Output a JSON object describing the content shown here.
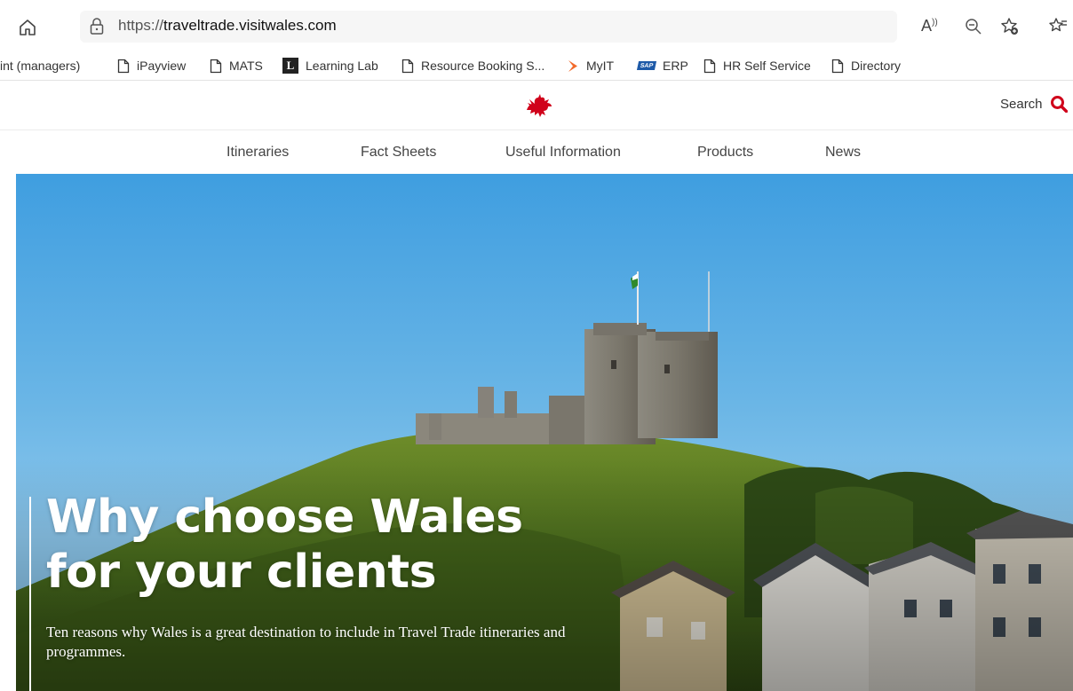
{
  "browser": {
    "url_prefix": "https://",
    "url_domain": "traveltrade.visitwales.com",
    "read_aloud_label": "A"
  },
  "bookmarks": [
    {
      "label": "int (managers)",
      "icon": "none"
    },
    {
      "label": "iPayview",
      "icon": "page-icon"
    },
    {
      "label": "MATS",
      "icon": "page-icon"
    },
    {
      "label": "Learning Lab",
      "icon": "learning-lab-icon"
    },
    {
      "label": "Resource Booking S...",
      "icon": "page-icon"
    },
    {
      "label": "MyIT",
      "icon": "myit-icon"
    },
    {
      "label": "ERP",
      "icon": "sap-icon"
    },
    {
      "label": "HR Self Service",
      "icon": "page-icon"
    },
    {
      "label": "Directory",
      "icon": "page-icon"
    }
  ],
  "site": {
    "search_label": "Search",
    "accent": "#d0021b",
    "nav": [
      "Itineraries",
      "Fact Sheets",
      "Useful Information",
      "Products",
      "News"
    ]
  },
  "hero": {
    "title": "Why choose Wales\nfor your clients",
    "subtitle": "Ten reasons why Wales is a great destination to include in Travel Trade itineraries and programmes."
  }
}
